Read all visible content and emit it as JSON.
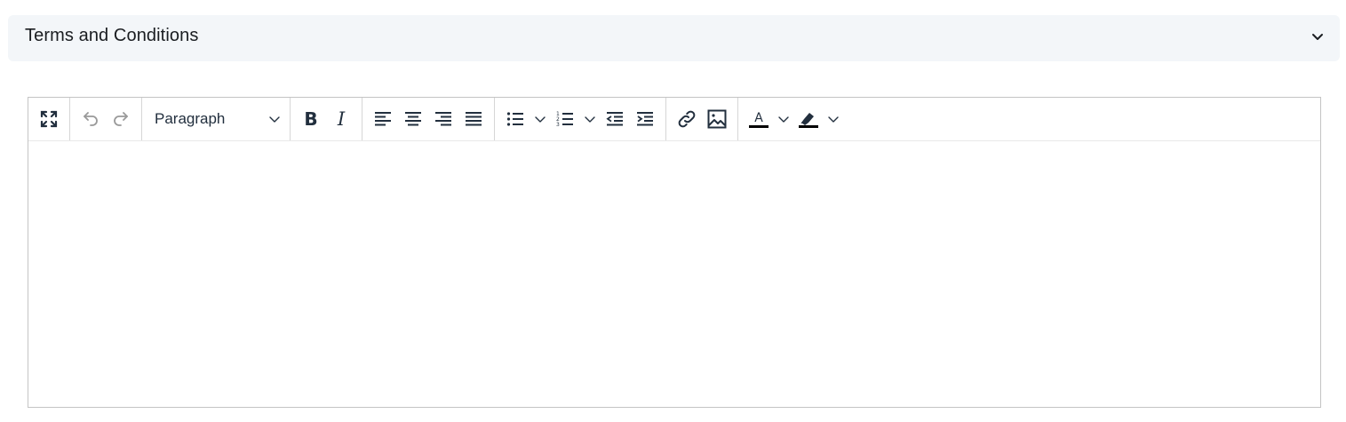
{
  "section": {
    "title": "Terms and Conditions",
    "expand_icon": "chevron-down-icon"
  },
  "editor": {
    "block_format": "Paragraph",
    "toolbar_icons": [
      "fullscreen-icon",
      "undo-icon",
      "redo-icon",
      "bold-icon",
      "italic-icon",
      "align-left-icon",
      "align-center-icon",
      "align-right-icon",
      "align-justify-icon",
      "bullet-list-icon",
      "numbered-list-icon",
      "outdent-icon",
      "indent-icon",
      "link-icon",
      "image-icon",
      "text-color-icon",
      "highlight-color-icon"
    ],
    "text_color": "#000000",
    "highlight_color": "#000000",
    "content": ""
  },
  "colors": {
    "header_bg": "#f3f6f9",
    "icon": "#222f3e",
    "icon_disabled": "#999999",
    "border": "#c4c4c4"
  }
}
